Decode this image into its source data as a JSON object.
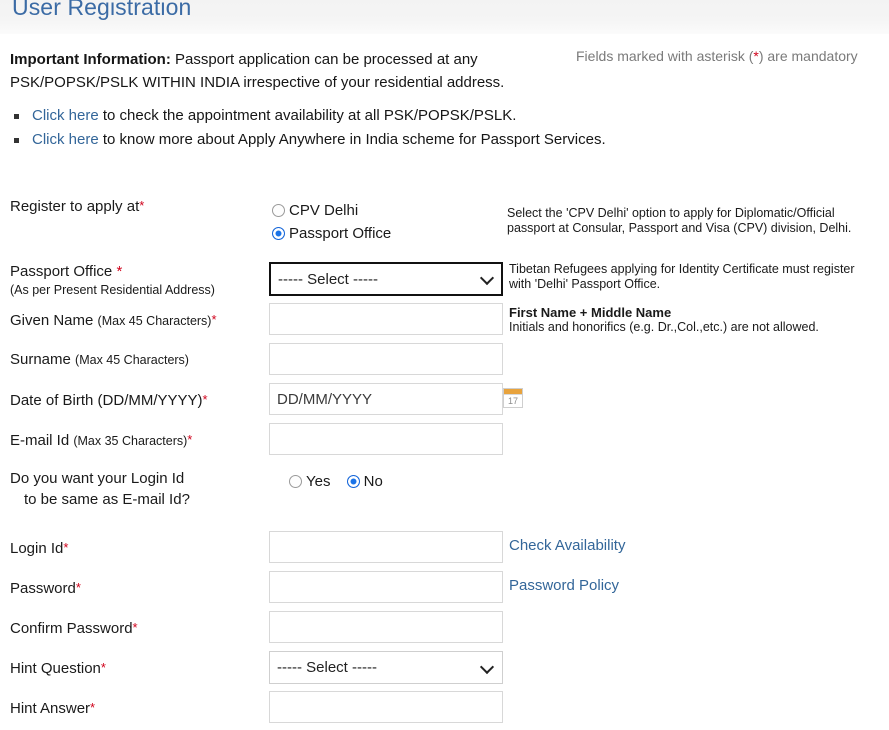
{
  "page": {
    "title": "User Registration"
  },
  "info": {
    "lead": "Important Information:",
    "body": " Passport application can be processed at any PSK/POPSK/PSLK WITHIN INDIA irrespective of your residential address.",
    "mandatory_pre": "Fields marked with asterisk (",
    "mandatory_ast": "*",
    "mandatory_post": ") are mandatory",
    "bullets": [
      {
        "link": "Click here",
        "rest": " to check the appointment availability at all PSK/POPSK/PSLK."
      },
      {
        "link": "Click here",
        "rest": " to know more about Apply Anywhere in India scheme for Passport Services."
      }
    ]
  },
  "form": {
    "register_at": {
      "label": "Register to apply at",
      "asterisk": "*",
      "options": [
        {
          "label": "CPV Delhi",
          "selected": false
        },
        {
          "label": "Passport Office",
          "selected": true
        }
      ],
      "help": "Select the 'CPV Delhi' option to apply for Diplomatic/Official passport at Consular, Passport and Visa (CPV) division, Delhi."
    },
    "passport_office": {
      "label": "Passport Office ",
      "asterisk": "*",
      "sublabel": "(As per Present Residential Address)",
      "value": "----- Select -----",
      "options": [
        "----- Select -----"
      ],
      "help": "Tibetan Refugees applying for Identity Certificate must register with 'Delhi' Passport Office."
    },
    "given_name": {
      "label": "Given Name ",
      "sublabel": "(Max 45 Characters)",
      "asterisk": "*",
      "value": "",
      "help_bold": "First Name + Middle Name",
      "help_rest": "Initials and honorifics (e.g. Dr.,Col.,etc.) are not allowed."
    },
    "surname": {
      "label": "Surname ",
      "sublabel": "(Max 45 Characters)",
      "asterisk": "",
      "value": ""
    },
    "dob": {
      "label": "Date of Birth (DD/MM/YYYY)",
      "asterisk": "*",
      "value": "",
      "placeholder": "DD/MM/YYYY",
      "calendar_icon": "calendar-icon",
      "calendar_day": "17"
    },
    "email": {
      "label": "E-mail Id ",
      "sublabel": "(Max 35 Characters)",
      "asterisk": "*",
      "value": ""
    },
    "login_same_as_email": {
      "label_line1": "Do you want your Login Id",
      "label_line2": "to be same as E-mail Id?",
      "options": [
        {
          "label": "Yes",
          "selected": false
        },
        {
          "label": "No",
          "selected": true
        }
      ]
    },
    "login_id": {
      "label": "Login Id",
      "asterisk": "*",
      "value": "",
      "side_link": "Check Availability"
    },
    "password": {
      "label": "Password",
      "asterisk": "*",
      "value": "",
      "side_link": "Password Policy"
    },
    "confirm_password": {
      "label": "Confirm Password",
      "asterisk": "*",
      "value": ""
    },
    "hint_question": {
      "label": "Hint Question",
      "asterisk": "*",
      "value": "----- Select -----",
      "options": [
        "----- Select -----"
      ]
    },
    "hint_answer": {
      "label": "Hint Answer",
      "asterisk": "*",
      "value": ""
    }
  },
  "colors": {
    "title": "#3b6ba5",
    "link": "#336699",
    "asterisk": "#d0021b",
    "radio_on": "#1a73e8",
    "calendar_header": "#e8a33d"
  }
}
